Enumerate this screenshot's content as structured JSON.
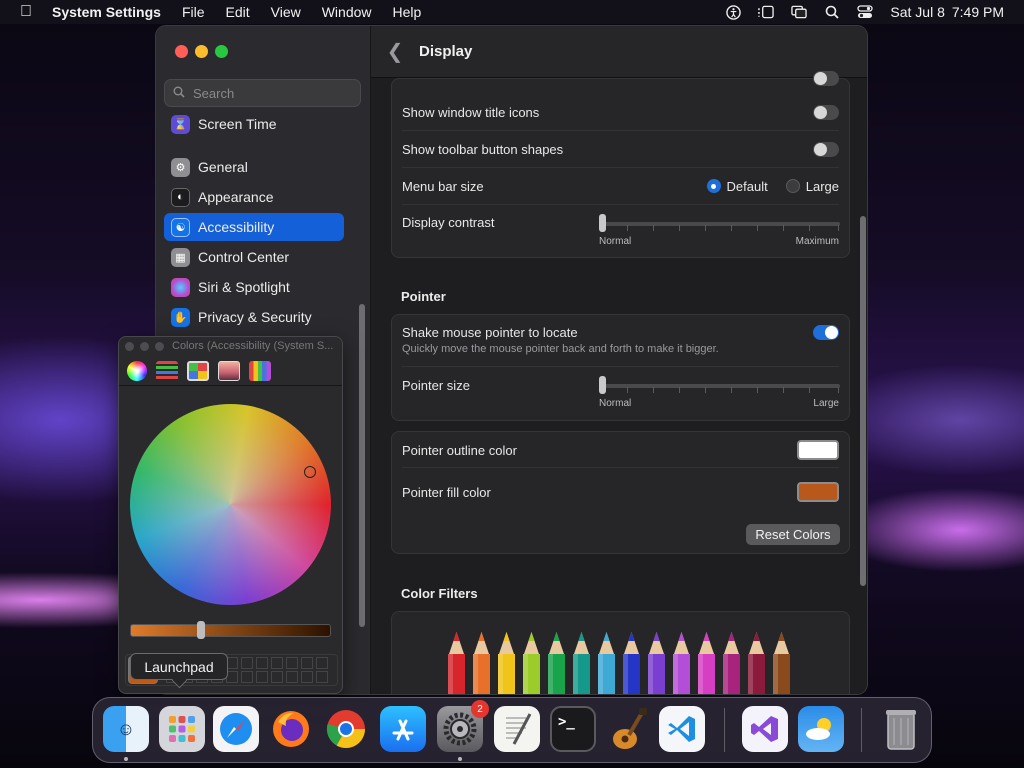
{
  "menubar": {
    "app_name": "System Settings",
    "items": [
      "File",
      "Edit",
      "View",
      "Window",
      "Help"
    ],
    "date": "Sat Jul 8",
    "time": "7:49 PM"
  },
  "sidebar": {
    "search_placeholder": "Search",
    "items": [
      {
        "label": "Screen Time",
        "icon": "hourglass-icon",
        "color": "#5e4bd6"
      },
      {
        "label": "General",
        "icon": "gear-icon",
        "color": "#8e8e93"
      },
      {
        "label": "Appearance",
        "icon": "appearance-icon",
        "color": "#1c1c1e"
      },
      {
        "label": "Accessibility",
        "icon": "accessibility-icon",
        "color": "#1473e6"
      },
      {
        "label": "Control Center",
        "icon": "control-center-icon",
        "color": "#8e8e93"
      },
      {
        "label": "Siri & Spotlight",
        "icon": "siri-icon",
        "color": "#b14fd6"
      },
      {
        "label": "Privacy & Security",
        "icon": "hand-icon",
        "color": "#1473e6"
      }
    ],
    "selected": "Accessibility"
  },
  "content": {
    "title": "Display",
    "display_group": {
      "show_window_title_icons": {
        "label": "Show window title icons",
        "on": false
      },
      "show_toolbar_button_shapes": {
        "label": "Show toolbar button shapes",
        "on": false
      },
      "menu_bar_size": {
        "label": "Menu bar size",
        "options": [
          "Default",
          "Large"
        ],
        "selected": "Default"
      },
      "display_contrast": {
        "label": "Display contrast",
        "min_label": "Normal",
        "max_label": "Maximum",
        "value": 0
      }
    },
    "pointer_section": {
      "title": "Pointer",
      "shake_to_locate": {
        "label": "Shake mouse pointer to locate",
        "description": "Quickly move the mouse pointer back and forth to make it bigger.",
        "on": true
      },
      "pointer_size": {
        "label": "Pointer size",
        "min_label": "Normal",
        "max_label": "Large",
        "value": 0
      },
      "outline_color": {
        "label": "Pointer outline color",
        "color": "#ffffff"
      },
      "fill_color": {
        "label": "Pointer fill color",
        "color": "#b8581a"
      },
      "reset_button": "Reset Colors"
    },
    "color_filters": {
      "title": "Color Filters"
    }
  },
  "colors_panel": {
    "title": "Colors (Accessibility (System S...",
    "tabs": [
      "color-wheel-icon",
      "sliders-icon",
      "palettes-icon",
      "image-palette-icon",
      "pencils-icon"
    ],
    "current_color": "#c25a14"
  },
  "tooltip": "Launchpad",
  "dock": {
    "apps": [
      {
        "name": "Finder",
        "icon": "finder-icon",
        "running": true
      },
      {
        "name": "Launchpad",
        "icon": "launchpad-icon",
        "running": false
      },
      {
        "name": "Safari",
        "icon": "safari-icon",
        "running": false
      },
      {
        "name": "Firefox",
        "icon": "firefox-icon",
        "running": false
      },
      {
        "name": "Chrome",
        "icon": "chrome-icon",
        "running": false
      },
      {
        "name": "App Store",
        "icon": "app-store-icon",
        "running": false
      },
      {
        "name": "System Settings",
        "icon": "system-settings-icon",
        "running": true,
        "badge": "2"
      },
      {
        "name": "TextEdit",
        "icon": "textedit-icon",
        "running": false
      },
      {
        "name": "Terminal",
        "icon": "terminal-icon",
        "running": false
      },
      {
        "name": "GarageBand",
        "icon": "garageband-icon",
        "running": false
      },
      {
        "name": "VS Code",
        "icon": "vscode-icon",
        "running": false
      },
      {
        "name": "Visual Studio",
        "icon": "visual-studio-icon",
        "running": false
      },
      {
        "name": "Weather",
        "icon": "weather-icon",
        "running": false
      },
      {
        "name": "Trash",
        "icon": "trash-icon",
        "running": false
      }
    ]
  },
  "pencil_colors": [
    "#d7262b",
    "#e8702a",
    "#f0c419",
    "#9ccc2a",
    "#19a34a",
    "#14998a",
    "#3fa9d6",
    "#2535c8",
    "#7a3fd0",
    "#b34ed6",
    "#d63ec4",
    "#a8237e",
    "#8c1a3c",
    "#8a4a1c"
  ]
}
